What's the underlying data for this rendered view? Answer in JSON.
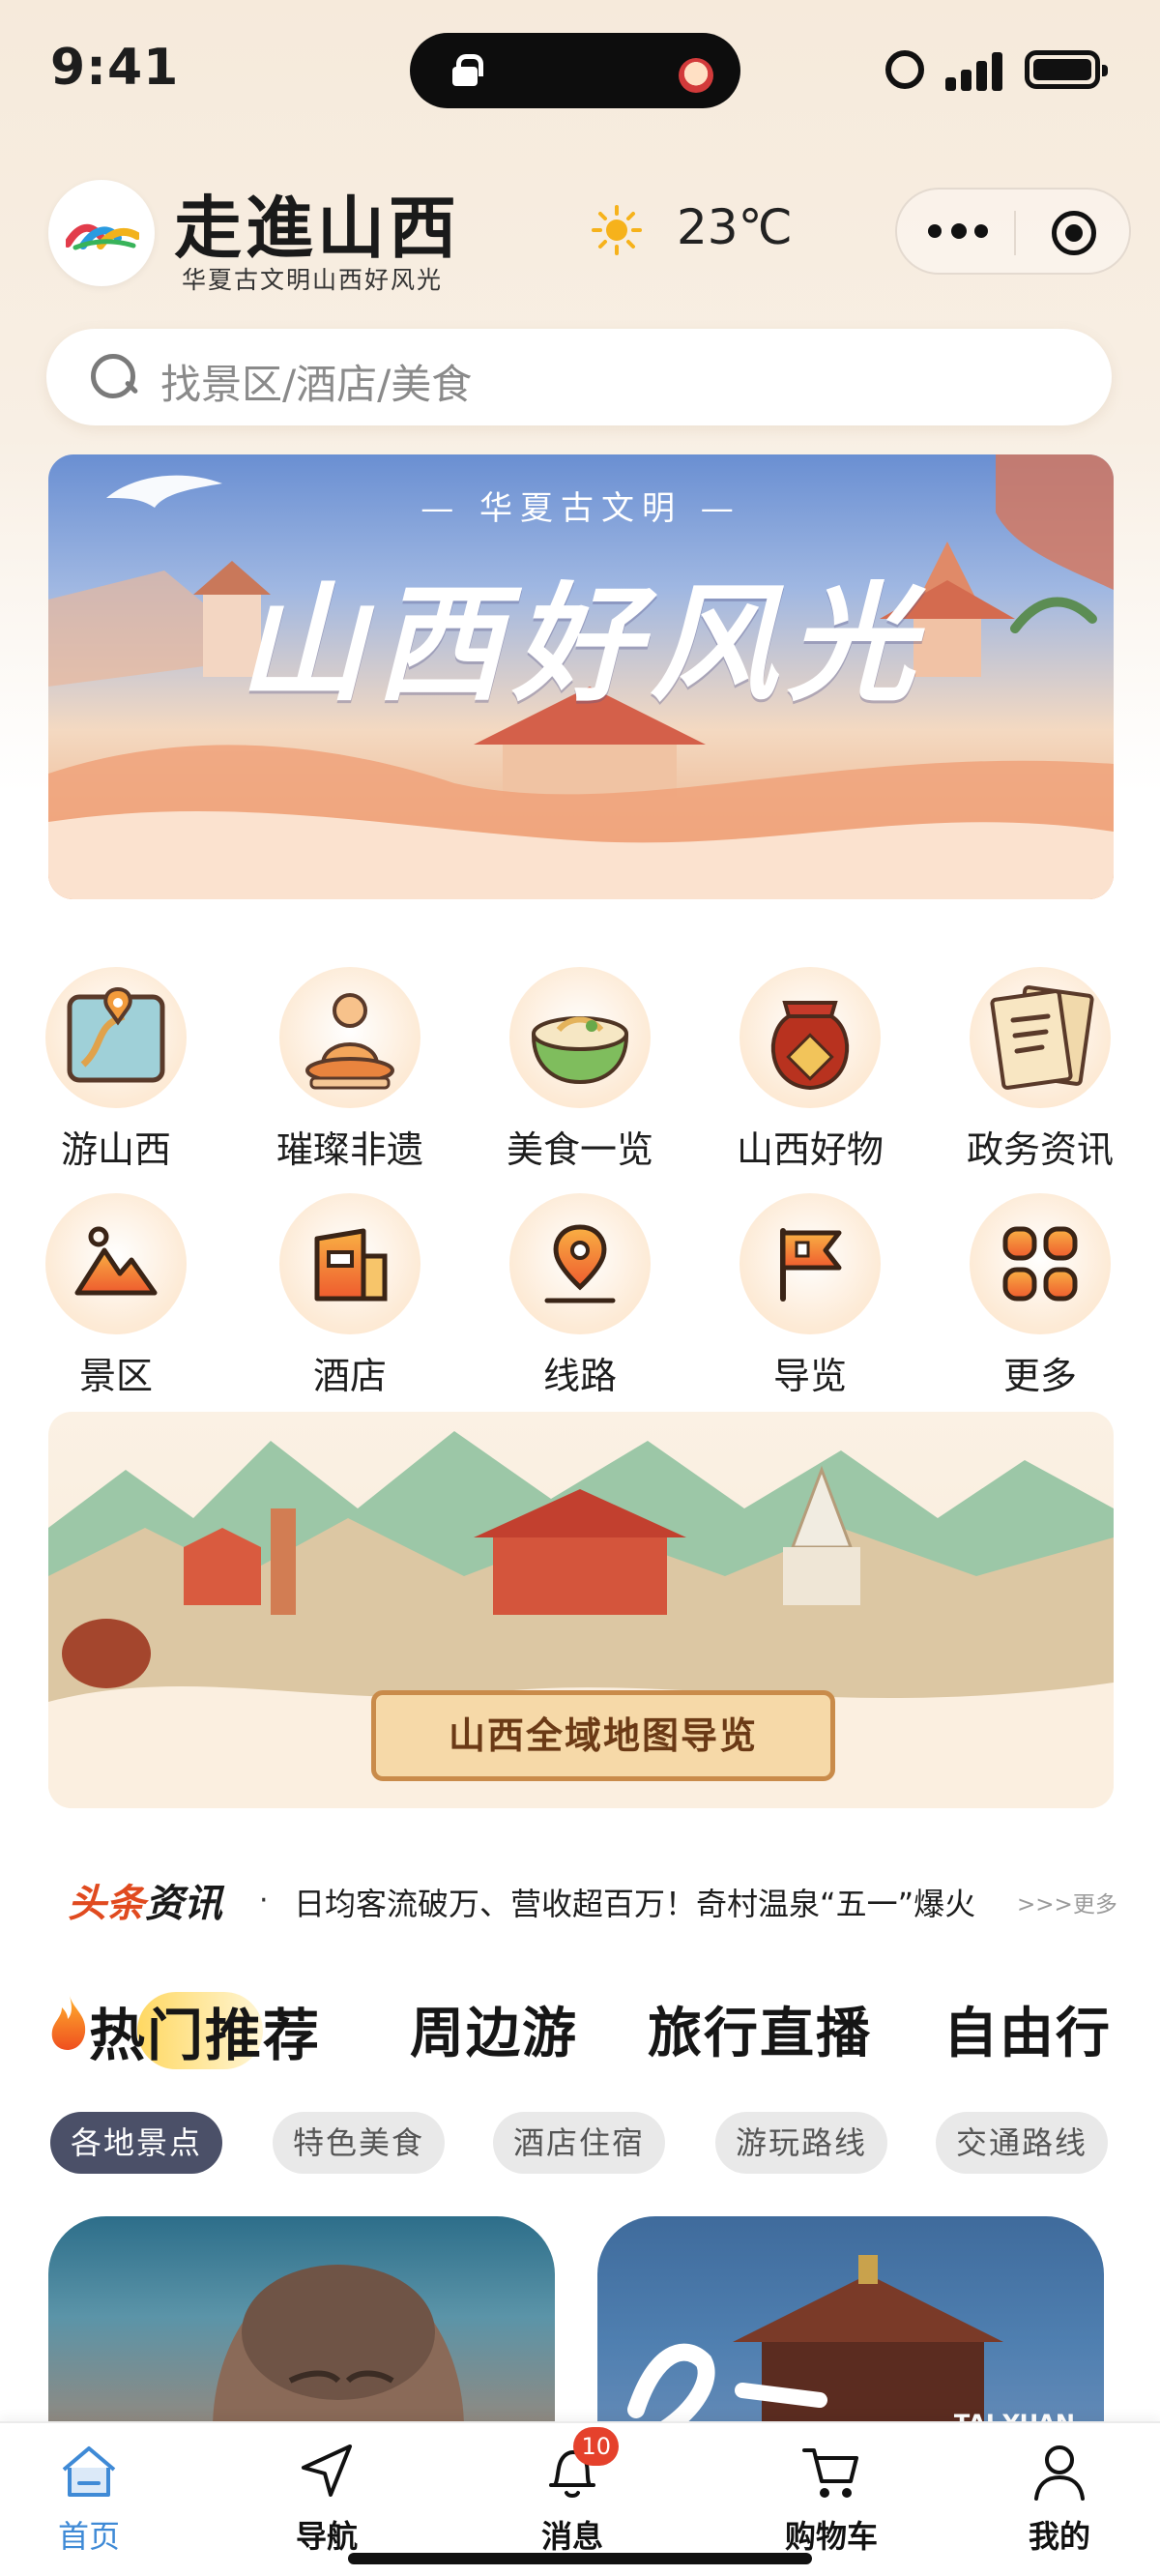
{
  "status_bar": {
    "time": "9:41"
  },
  "header": {
    "title": "走進山西",
    "subtitle": "华夏古文明山西好风光",
    "weather": {
      "icon": "sun-icon",
      "temperature": "23℃"
    }
  },
  "search": {
    "placeholder": "找景区/酒店/美食"
  },
  "hero_banner": {
    "kicker": "— 华夏古文明 —",
    "title": "山西好风光"
  },
  "categories_row1": [
    {
      "label": "游山西",
      "icon": "map-route-icon"
    },
    {
      "label": "璀璨非遗",
      "icon": "buddha-statue-icon"
    },
    {
      "label": "美食一览",
      "icon": "noodle-bowl-icon"
    },
    {
      "label": "山西好物",
      "icon": "vinegar-jar-icon"
    },
    {
      "label": "政务资讯",
      "icon": "document-scroll-icon"
    }
  ],
  "categories_row2": [
    {
      "label": "景区",
      "icon": "mountain-icon"
    },
    {
      "label": "酒店",
      "icon": "hotel-icon"
    },
    {
      "label": "线路",
      "icon": "location-pin-icon"
    },
    {
      "label": "导览",
      "icon": "flag-icon"
    },
    {
      "label": "更多",
      "icon": "grid-more-icon"
    }
  ],
  "map_banner": {
    "label": "山西全域地图导览"
  },
  "news": {
    "badge_part1": "头条",
    "badge_part2": "资讯",
    "dot": "·",
    "headline": "日均客流破万、营收超百万！奇村温泉“五一”爆火",
    "more": ">>>更多"
  },
  "tabs": [
    "热门推荐",
    "周边游",
    "旅行直播",
    "自由行"
  ],
  "chips": [
    "各地景点",
    "特色美食",
    "酒店住宿",
    "游玩路线",
    "交通路线"
  ],
  "cards": [
    {
      "name": "buddha-card",
      "tag": ""
    },
    {
      "name": "taiyuan-card",
      "tag": "TAI YUAN"
    }
  ],
  "tabbar": [
    {
      "label": "首页",
      "icon": "home-icon",
      "active": true
    },
    {
      "label": "导航",
      "icon": "navigation-arrow-icon"
    },
    {
      "label": "消息",
      "icon": "bell-icon",
      "badge": "10"
    },
    {
      "label": "购物车",
      "icon": "cart-icon"
    },
    {
      "label": "我的",
      "icon": "user-icon"
    }
  ],
  "colors": {
    "accent_blue": "#3f8ad6",
    "news_red": "#e04a1f",
    "chip_active": "#4b5068",
    "badge_red": "#e5412c",
    "tab_highlight": "#ffd65a"
  }
}
